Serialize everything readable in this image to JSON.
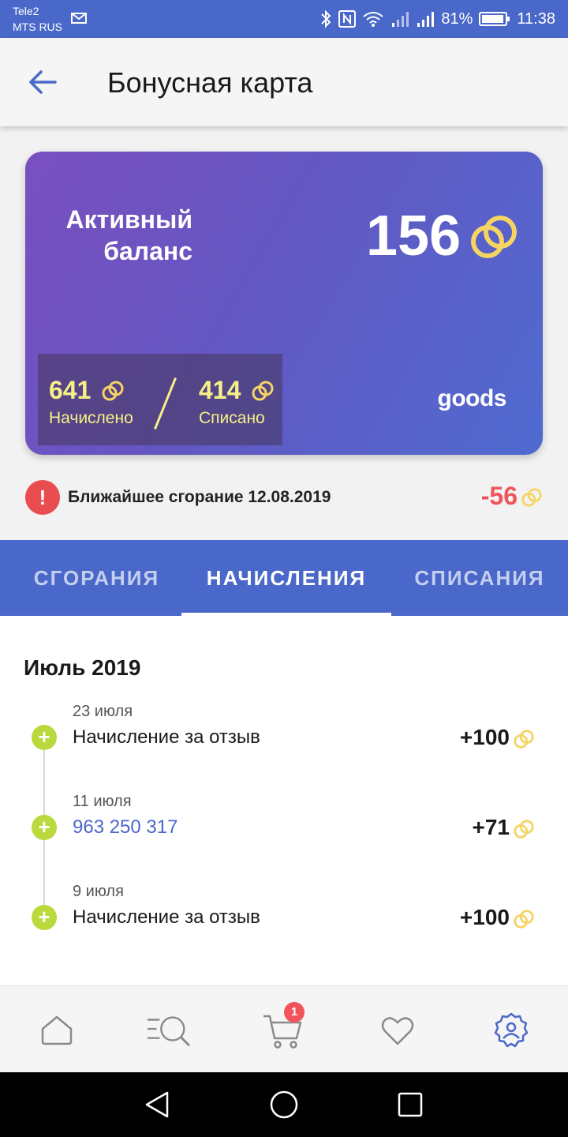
{
  "status_bar": {
    "carrier_1": "Tele2",
    "carrier_2": "MTS RUS",
    "battery": "81%",
    "time": "11:38"
  },
  "app_bar": {
    "title": "Бонусная карта",
    "back_icon": "arrow-left-icon"
  },
  "card": {
    "label_line1": "Активный",
    "label_line2": "баланс",
    "balance": "156",
    "accrued_value": "641",
    "accrued_label": "Начислено",
    "spent_value": "414",
    "spent_label": "Списано",
    "brand": "goods",
    "coin_color": "#f5d463"
  },
  "expiry": {
    "text": "Ближайшее сгорание 12.08.2019",
    "amount": "-56",
    "icon": "exclamation-icon"
  },
  "tabs": [
    {
      "label": "СГОРАНИЯ",
      "active": false
    },
    {
      "label": "НАЧИСЛЕНИЯ",
      "active": true
    },
    {
      "label": "СПИСАНИЯ",
      "active": false
    }
  ],
  "history": {
    "month": "Июль 2019",
    "entries": [
      {
        "date": "23 июля",
        "title": "Начисление за отзыв",
        "amount": "+100",
        "is_link": false
      },
      {
        "date": "11 июля",
        "title": "963 250 317",
        "amount": "+71",
        "is_link": true
      },
      {
        "date": "9 июля",
        "title": "Начисление за отзыв",
        "amount": "+100",
        "is_link": false
      }
    ]
  },
  "bottom_nav": {
    "items": [
      "home-icon",
      "catalog-search-icon",
      "cart-icon",
      "heart-icon",
      "profile-settings-icon"
    ],
    "cart_badge": "1"
  },
  "colors": {
    "primary": "#4a68c9",
    "accent_red": "#f0545a",
    "accent_green": "#b9d93d",
    "stat_yellow": "#f6f086"
  }
}
